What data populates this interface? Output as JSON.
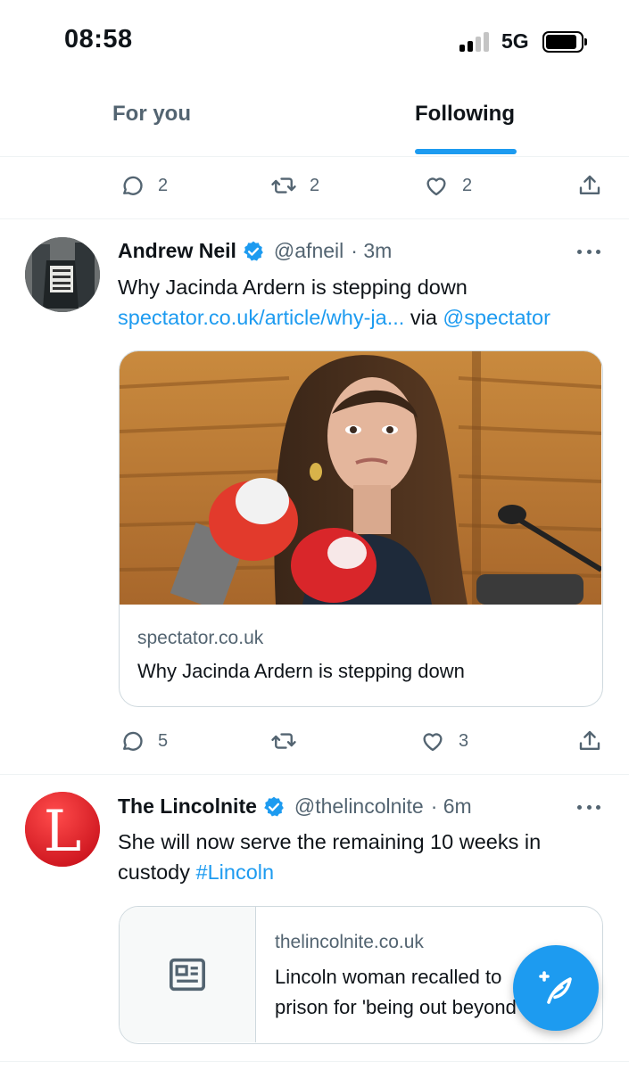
{
  "status_bar": {
    "time": "08:58",
    "network": "5G"
  },
  "tabs": [
    {
      "label": "For you",
      "active": false
    },
    {
      "label": "Following",
      "active": true
    }
  ],
  "prev_tweet_actions": {
    "replies": "2",
    "retweets": "2",
    "likes": "2"
  },
  "tweets": [
    {
      "name": "Andrew Neil",
      "handle": "@afneil",
      "time": "· 3m",
      "avatar_icon": "profile-photo",
      "verified": true,
      "text": "Why Jacinda Ardern is stepping down",
      "link_text": "spectator.co.uk/article/why-ja...",
      "via": " via ",
      "mention": "@spectator",
      "card": {
        "domain": "spectator.co.uk",
        "title": "Why Jacinda Ardern is stepping down"
      },
      "actions": {
        "replies": "5",
        "retweets": "",
        "likes": "3"
      }
    },
    {
      "name": "The Lincolnite",
      "handle": "@thelincolnite",
      "time": "· 6m",
      "avatar_letter": "L",
      "verified": true,
      "text_line1": "She will now serve the remaining 10 weeks in",
      "text_line2": "custody ",
      "hashtag": "#Lincoln",
      "card": {
        "domain": "thelincolnite.co.uk",
        "title_line1": "Lincoln woman recalled to",
        "title_line2": "prison for 'being out beyond"
      }
    }
  ],
  "colors": {
    "accent": "#1d9bf0",
    "text": "#0f1419",
    "muted": "#536471",
    "border": "#cfd9de",
    "lincolnite_red": "#e41e26"
  },
  "icons": [
    "reply-icon",
    "retweet-icon",
    "like-icon",
    "share-icon",
    "verified-icon",
    "more-icon",
    "article-icon",
    "compose-icon"
  ]
}
